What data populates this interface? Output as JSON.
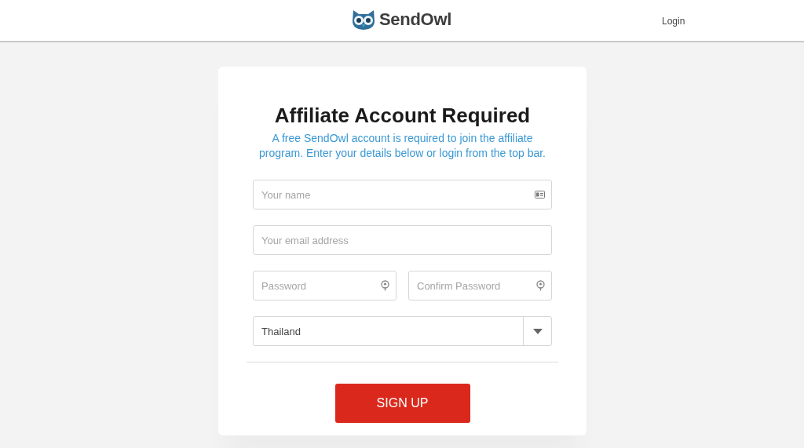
{
  "header": {
    "brand": "SendOwl",
    "login": "Login"
  },
  "card": {
    "title": "Affiliate Account Required",
    "subtitle": "A free SendOwl account is required to join the affiliate program. Enter your details below or login from the top bar.",
    "rows": [
      [
        {
          "kind": "name",
          "placeholder": "Your name"
        }
      ],
      [
        {
          "kind": "email",
          "placeholder": "Your email address"
        }
      ],
      [
        {
          "kind": "password",
          "placeholder": "Password"
        },
        {
          "kind": "password",
          "placeholder": "Confirm Password"
        }
      ],
      [
        {
          "kind": "select",
          "value": "Thailand"
        }
      ]
    ],
    "button": "SIGN UP"
  }
}
